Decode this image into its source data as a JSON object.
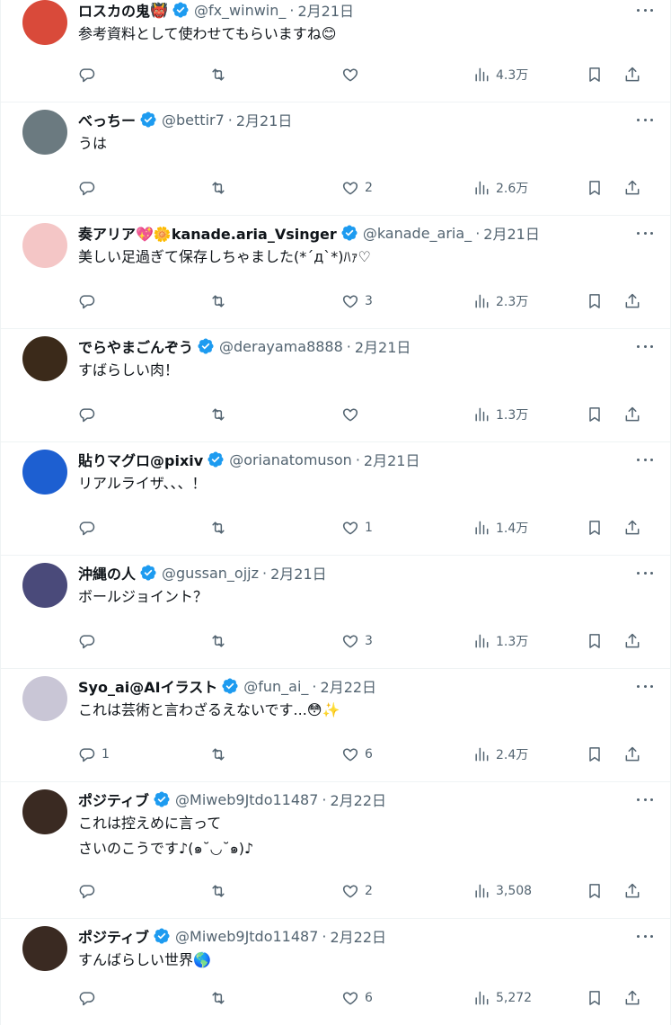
{
  "tweets": [
    {
      "name": "ロスカの鬼",
      "name_emoji": "👹",
      "handle": "@fx_winwin_",
      "dot": "·",
      "date": "2月21日",
      "text": "参考資料として使わせてもらいますね",
      "text_emoji": "😊",
      "replies": "",
      "retweets": "",
      "likes": "",
      "views": "4.3万",
      "avatar_color": "#d94a3a",
      "avatar_icon": "demon-avatar"
    },
    {
      "name": "べっちー",
      "handle": "@bettir7",
      "dot": "·",
      "date": "2月21日",
      "text": "うは",
      "replies": "",
      "retweets": "",
      "likes": "2",
      "views": "2.6万",
      "avatar_color": "#6b7a80",
      "avatar_icon": "car-avatar"
    },
    {
      "name": "奏アリア💖🌼kanade.aria_Vsinger",
      "handle": "@kanade_aria_",
      "dot": "·",
      "date": "2月21日",
      "text": "美しい足過ぎて保存しちゃました(*´д`*)ﾊｧ♡",
      "replies": "",
      "retweets": "",
      "likes": "3",
      "views": "2.3万",
      "avatar_color": "#f4c6c6",
      "avatar_icon": "anime-girl-avatar"
    },
    {
      "name": "でらやまごんぞう",
      "handle": "@derayama8888",
      "dot": "·",
      "date": "2月21日",
      "text": "すばらしい肉！",
      "replies": "",
      "retweets": "",
      "likes": "",
      "views": "1.3万",
      "avatar_color": "#3b2a1a",
      "avatar_icon": "afro-man-avatar"
    },
    {
      "name": "貼りマグロ@pixiv",
      "handle": "@orianatomuson",
      "dot": "·",
      "date": "2月21日",
      "text": "リアルライザ、、、！",
      "replies": "",
      "retweets": "",
      "likes": "1",
      "views": "1.4万",
      "avatar_color": "#1d5fd1",
      "avatar_icon": "tuna-avatar"
    },
    {
      "name": "沖縄の人",
      "handle": "@gussan_ojjz",
      "dot": "·",
      "date": "2月21日",
      "text": "ボールジョイント？",
      "replies": "",
      "retweets": "",
      "likes": "3",
      "views": "1.3万",
      "avatar_color": "#4a4a7a",
      "avatar_icon": "anime-character-avatar"
    },
    {
      "name": "Syo_ai@AIイラスト",
      "handle": "@fun_ai_",
      "dot": "·",
      "date": "2月22日",
      "text": "これは芸術と言わざるえないです...",
      "text_emoji": "😳✨",
      "replies": "1",
      "retweets": "",
      "likes": "6",
      "views": "2.4万",
      "avatar_color": "#c9c6d6",
      "avatar_icon": "silver-hair-girl-avatar"
    },
    {
      "name": "ポジティブ",
      "handle": "@Miweb9Jtdo11487",
      "dot": "·",
      "date": "2月22日",
      "text": "これは控えめに言って\nさいのこうです♪(๑˘◡˘๑)♪",
      "replies": "",
      "retweets": "",
      "likes": "2",
      "views": "3,508",
      "avatar_color": "#3a2a22",
      "avatar_icon": "text-image-avatar"
    },
    {
      "name": "ポジティブ",
      "handle": "@Miweb9Jtdo11487",
      "dot": "·",
      "date": "2月22日",
      "text": "すんばらしい世界",
      "text_emoji": "🌎",
      "replies": "",
      "retweets": "",
      "likes": "6",
      "views": "5,272",
      "avatar_color": "#3a2a22",
      "avatar_icon": "text-image-avatar"
    }
  ],
  "colors": {
    "text": "#0f1419",
    "muted": "#536471",
    "verified": "#1d9bf0",
    "divider": "#eff3f4"
  }
}
